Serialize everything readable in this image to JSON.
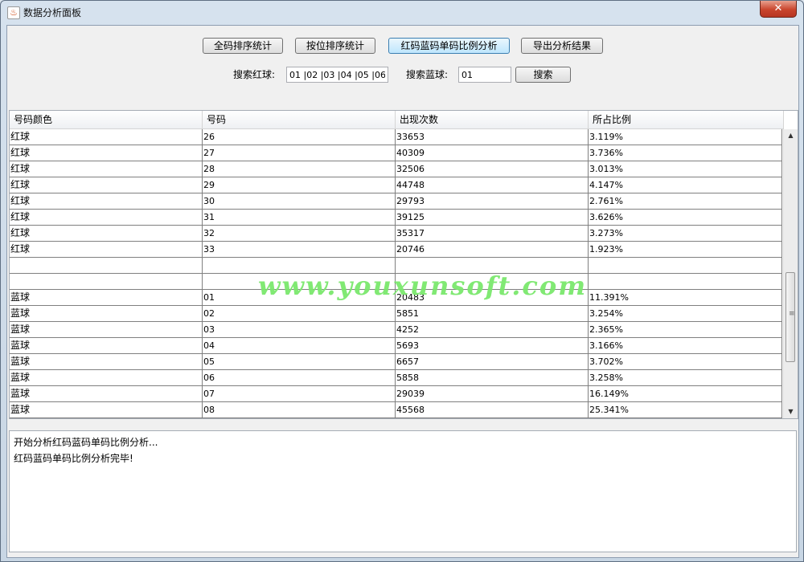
{
  "window": {
    "title": "数据分析面板",
    "close_label": "✕",
    "icon_glyph": "♨"
  },
  "toolbar": {
    "buttons": [
      "全码排序统计",
      "按位排序统计",
      "红码蓝码单码比例分析",
      "导出分析结果"
    ],
    "active_index": 2
  },
  "search": {
    "red_label": "搜索红球:",
    "red_value": "01 |02 |03 |04 |05 |06",
    "blue_label": "搜索蓝球:",
    "blue_value": "01",
    "button_label": "搜索"
  },
  "table": {
    "columns": [
      "号码颜色",
      "号码",
      "出现次数",
      "所占比例"
    ],
    "rows": [
      [
        "红球",
        "26",
        "33653",
        "3.119%"
      ],
      [
        "红球",
        "27",
        "40309",
        "3.736%"
      ],
      [
        "红球",
        "28",
        "32506",
        "3.013%"
      ],
      [
        "红球",
        "29",
        "44748",
        "4.147%"
      ],
      [
        "红球",
        "30",
        "29793",
        "2.761%"
      ],
      [
        "红球",
        "31",
        "39125",
        "3.626%"
      ],
      [
        "红球",
        "32",
        "35317",
        "3.273%"
      ],
      [
        "红球",
        "33",
        "20746",
        "1.923%"
      ],
      [
        "",
        "",
        "",
        ""
      ],
      [
        "",
        "",
        "",
        ""
      ],
      [
        "蓝球",
        "01",
        "20483",
        "11.391%"
      ],
      [
        "蓝球",
        "02",
        "5851",
        "3.254%"
      ],
      [
        "蓝球",
        "03",
        "4252",
        "2.365%"
      ],
      [
        "蓝球",
        "04",
        "5693",
        "3.166%"
      ],
      [
        "蓝球",
        "05",
        "6657",
        "3.702%"
      ],
      [
        "蓝球",
        "06",
        "5858",
        "3.258%"
      ],
      [
        "蓝球",
        "07",
        "29039",
        "16.149%"
      ],
      [
        "蓝球",
        "08",
        "45568",
        "25.341%"
      ]
    ]
  },
  "watermark": "www.youxunsoft.com",
  "log": {
    "lines": [
      "开始分析红码蓝码单码比例分析...",
      "红码蓝码单码比例分析完毕!"
    ]
  },
  "colors": {
    "close": "#c9452d",
    "active_button": "#bee6fd",
    "watermark": "#7be86d"
  }
}
